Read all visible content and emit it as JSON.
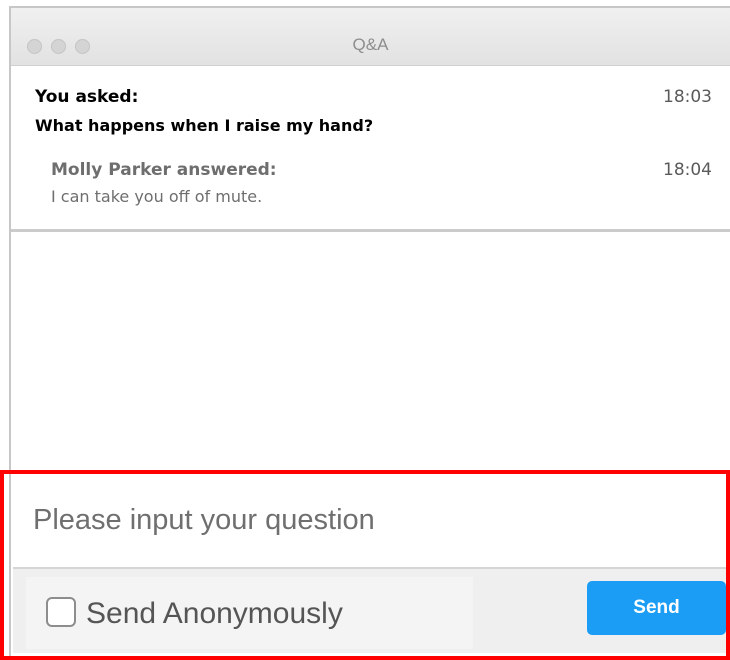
{
  "window": {
    "title": "Q&A"
  },
  "qa": {
    "question": {
      "label": "You asked:",
      "time": "18:03",
      "text": "What happens when I raise my hand?"
    },
    "answer": {
      "label": "Molly Parker answered:",
      "time": "18:04",
      "text": "I can take you off of mute."
    }
  },
  "composer": {
    "placeholder": "Please input your question",
    "anonymous_label": "Send Anonymously",
    "anonymous_checked": false,
    "send_label": "Send"
  },
  "colors": {
    "send_button": "#1c9df5",
    "highlight_border": "#ff0000"
  }
}
